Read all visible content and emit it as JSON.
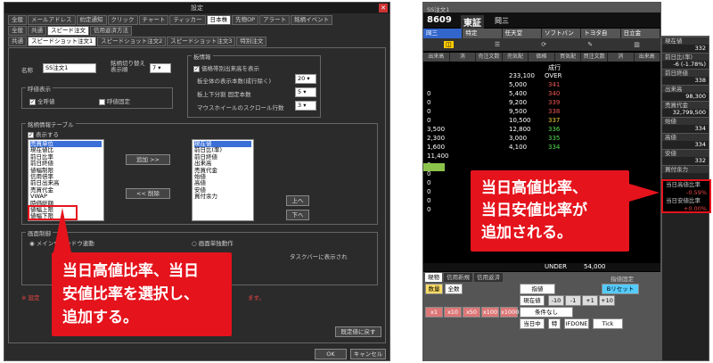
{
  "settings_dialog": {
    "title": "設定",
    "main_tabs": [
      "全般",
      "メールアドレス",
      "約定通知",
      "クリック",
      "チャート",
      "ティッカー",
      "日本株",
      "先物OP",
      "アラート",
      "銘柄イベント"
    ],
    "sub_tabs": [
      "全般",
      "共通",
      "スピード注文",
      "信用返済方法"
    ],
    "sub_tabs2": [
      "共通",
      "スピードショット注文1",
      "スピードショット注文2",
      "スピードショット注文3",
      "特別注文"
    ],
    "name_label": "名称",
    "name_value": "SS注文1",
    "shortcut_label": "銘柄切り替え\n表示順",
    "shortcut_value": "7",
    "price_display_label": "呼値表示",
    "all_ticks_label": "全呼値",
    "tick_fixed_label": "呼値固定",
    "board_settings_label": "板情報",
    "show_fraction_label": "価格帯別出来高を表示",
    "rows_label": "板全体の表示本数(成行除く)",
    "rows_value": "20",
    "updown_label": "板上下分割 固定本数",
    "updown_value": "5",
    "scroll_label": "マウスホイールのスクロール行数",
    "scroll_value": "3",
    "info_table_label": "銘柄情報テーブル",
    "show_label": "表示する",
    "left_list": [
      "売買単位",
      "現在値比",
      "前日比率",
      "前日終値",
      "値幅制限",
      "信用倍率",
      "前日出来高",
      "売買代金",
      "VWAP",
      "時価総額",
      "値幅上限",
      "値幅下限",
      "当日高値比率",
      "当日安値比率"
    ],
    "left_selected_index": 0,
    "right_list": [
      "現在値",
      "前日比(率)",
      "前日終値",
      "出来高",
      "売買代金",
      "始値",
      "高値",
      "安値",
      "買付余力"
    ],
    "add_button": "追加 >>",
    "remove_button": "<< 削除",
    "up_button": "上へ",
    "down_button": "下へ",
    "screen_control_label": "画面制御",
    "radio1_label": "メインウィンドウ連動",
    "radio2_label": "画面単独動作",
    "taskbar_label": "タスクバーに表示され",
    "note_text": "※ 設定",
    "note_tail": "ます。",
    "reset_button": "既定値に戻す",
    "ok_button": "OK",
    "cancel_button": "キャンセル"
  },
  "left_callout": "当日高値比率、当日\n安値比率を選択し、\n追加する。",
  "right_callout": "当日高値比率、\n当日安値比率が\n追加される。",
  "order_window": {
    "title": "SS注文1",
    "code": "8609",
    "market": "東証",
    "company": "岡三",
    "tabs": [
      "岡三",
      "特定",
      "任天堂",
      "ソフトバン",
      "トヨタ自",
      "日立金"
    ],
    "columns": [
      "出来高",
      "消",
      "売注文数",
      "売気配",
      "価格",
      "買気配",
      "買注文数",
      "消",
      "出来高"
    ],
    "market_order_label": "成行",
    "over_label": "OVER",
    "over_qty": "233,100",
    "under_label": "UNDER",
    "under_qty": "54,000",
    "rows": [
      {
        "sell": "5,000",
        "price": "341"
      },
      {
        "sell": "5,400",
        "price": "340"
      },
      {
        "sell": "9,200",
        "price": "339"
      },
      {
        "sell": "9,500",
        "price": "338"
      },
      {
        "sell": "10,500",
        "price": "337"
      },
      {
        "sell": "12,800",
        "price": "336"
      },
      {
        "sell": "3,000",
        "price": "335"
      },
      {
        "sell": "4,100",
        "price": "334"
      }
    ],
    "left_vols": [
      "0",
      "0",
      "0",
      "0",
      "3,500",
      "2,300",
      "1,600",
      "11,400",
      "0",
      "0",
      "0",
      "0",
      "0",
      "0"
    ],
    "bottom_tabs": [
      "現物",
      "信用新規",
      "信用返済"
    ],
    "bottom_tail": [
      "数量",
      "全数",
      "数量"
    ],
    "qty_label": "数量",
    "all_label": "全数",
    "cond_label": "指値",
    "expire_label": "当日中",
    "tick_label": "Tick",
    "current_label": "現在値",
    "unit_label": "特",
    "pre_label": "IFDONE",
    "multiplier_buttons": [
      "x1",
      "x10",
      "x50",
      "x100",
      "x1000"
    ],
    "offset_buttons": [
      "-10",
      "-1",
      "+1",
      "+10"
    ],
    "reset_label": "Bリセット",
    "fix_label": "指値固定",
    "rule_label": "条件なし"
  },
  "info_panel": {
    "items": [
      {
        "k": "現在値",
        "v": "332"
      },
      {
        "k": "前日比(率)",
        "v": "-6 (-1.78%)"
      },
      {
        "k": "前日終値",
        "v": "338"
      },
      {
        "k": "出来高",
        "v": "98,300"
      },
      {
        "k": "売買代金",
        "v": "32,799,500"
      },
      {
        "k": "始値",
        "v": "334"
      },
      {
        "k": "高値",
        "v": "334"
      },
      {
        "k": "安値",
        "v": "332"
      },
      {
        "k": "買付余力",
        "v": ""
      }
    ],
    "new_items": [
      {
        "k": "当日高値比率",
        "v": "-0.59%"
      },
      {
        "k": "当日安値比率",
        "v": "+0.00%"
      }
    ]
  }
}
